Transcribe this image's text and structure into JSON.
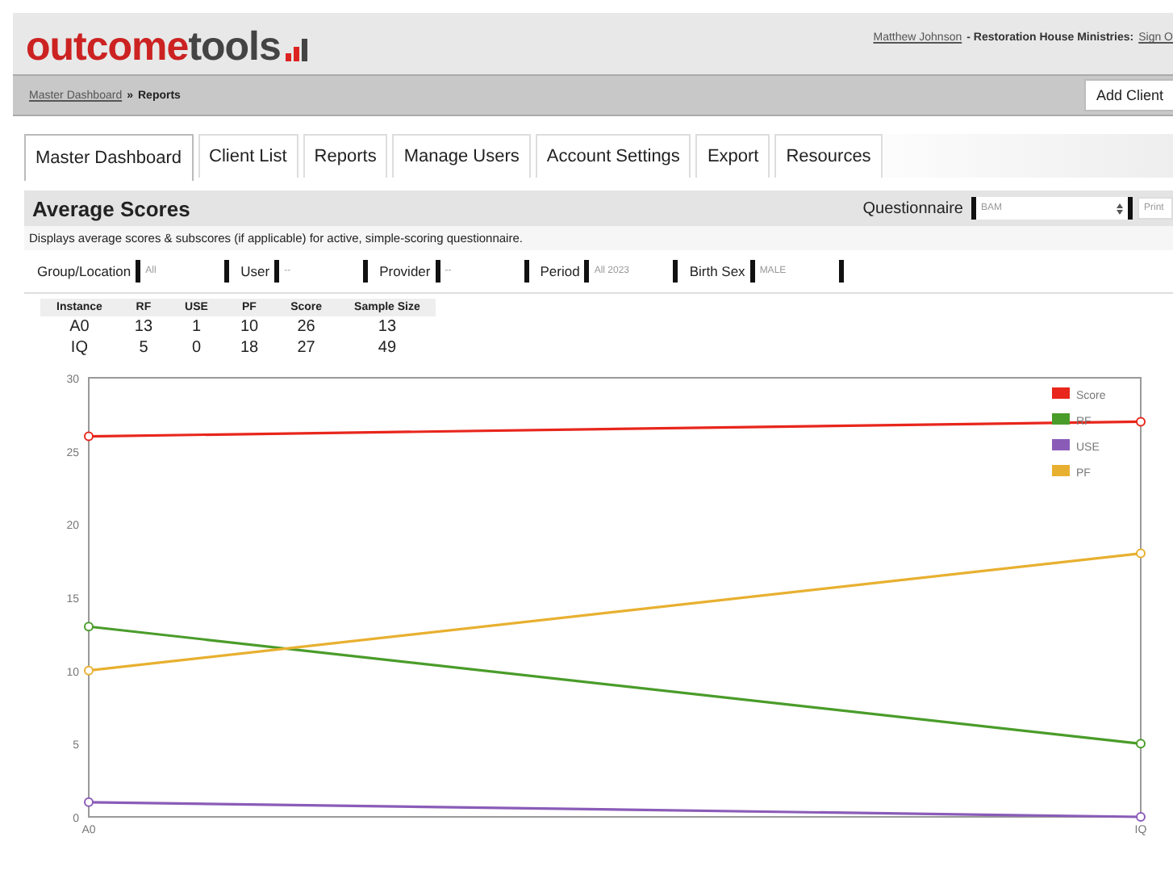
{
  "header": {
    "logo_main": "outcome",
    "logo_accent": "tools",
    "user": "Matthew Johnson",
    "org": "- Restoration House Ministries:",
    "sign_out": "Sign O"
  },
  "breadcrumb": {
    "link": "Master Dashboard",
    "separator": "»",
    "current": "Reports",
    "button": "Add Client"
  },
  "tabs": [
    {
      "label": "Master Dashboard",
      "selected": true
    },
    {
      "label": "Client List",
      "selected": false
    },
    {
      "label": "Reports",
      "selected": false
    },
    {
      "label": "Manage Users",
      "selected": false
    },
    {
      "label": "Account Settings",
      "selected": false
    },
    {
      "label": "Export",
      "selected": false
    },
    {
      "label": "Resources",
      "selected": false
    }
  ],
  "section": {
    "title": "Average Scores",
    "questionnaire_label": "Questionnaire",
    "questionnaire_value": "BAM",
    "print_value": "Print",
    "description": "Displays average scores & subscores (if applicable) for active, simple-scoring questionnaire."
  },
  "filters": [
    {
      "label": "Group/Location",
      "value": "All"
    },
    {
      "label": "User",
      "value": "--"
    },
    {
      "label": "Provider",
      "value": "--"
    },
    {
      "label": "Period",
      "value": "All 2023"
    },
    {
      "label": "Birth Sex",
      "value": "MALE"
    }
  ],
  "table": {
    "columns": [
      "Instance",
      "RF",
      "USE",
      "PF",
      "Score",
      "Sample Size"
    ],
    "rows": [
      [
        "A0",
        "13",
        "1",
        "10",
        "26",
        "13"
      ],
      [
        "IQ",
        "5",
        "0",
        "18",
        "27",
        "49"
      ]
    ]
  },
  "chart_data": {
    "type": "line",
    "legend": true,
    "categories": [
      "A0",
      "IQ"
    ],
    "ylim": [
      0,
      30
    ],
    "yticks": [
      0,
      5,
      10,
      15,
      20,
      25,
      30
    ],
    "series": [
      {
        "name": "Score",
        "color": "#e8261c",
        "values": [
          26,
          27
        ],
        "marker": "circle"
      },
      {
        "name": "RF",
        "color": "#4a9c2a",
        "values": [
          13,
          5
        ],
        "marker": "circle"
      },
      {
        "name": "USE",
        "color": "#8a5cb8",
        "values": [
          1,
          0
        ],
        "marker": "circle"
      },
      {
        "name": "PF",
        "color": "#e8b030",
        "values": [
          10,
          18
        ],
        "marker": "circle"
      }
    ]
  }
}
